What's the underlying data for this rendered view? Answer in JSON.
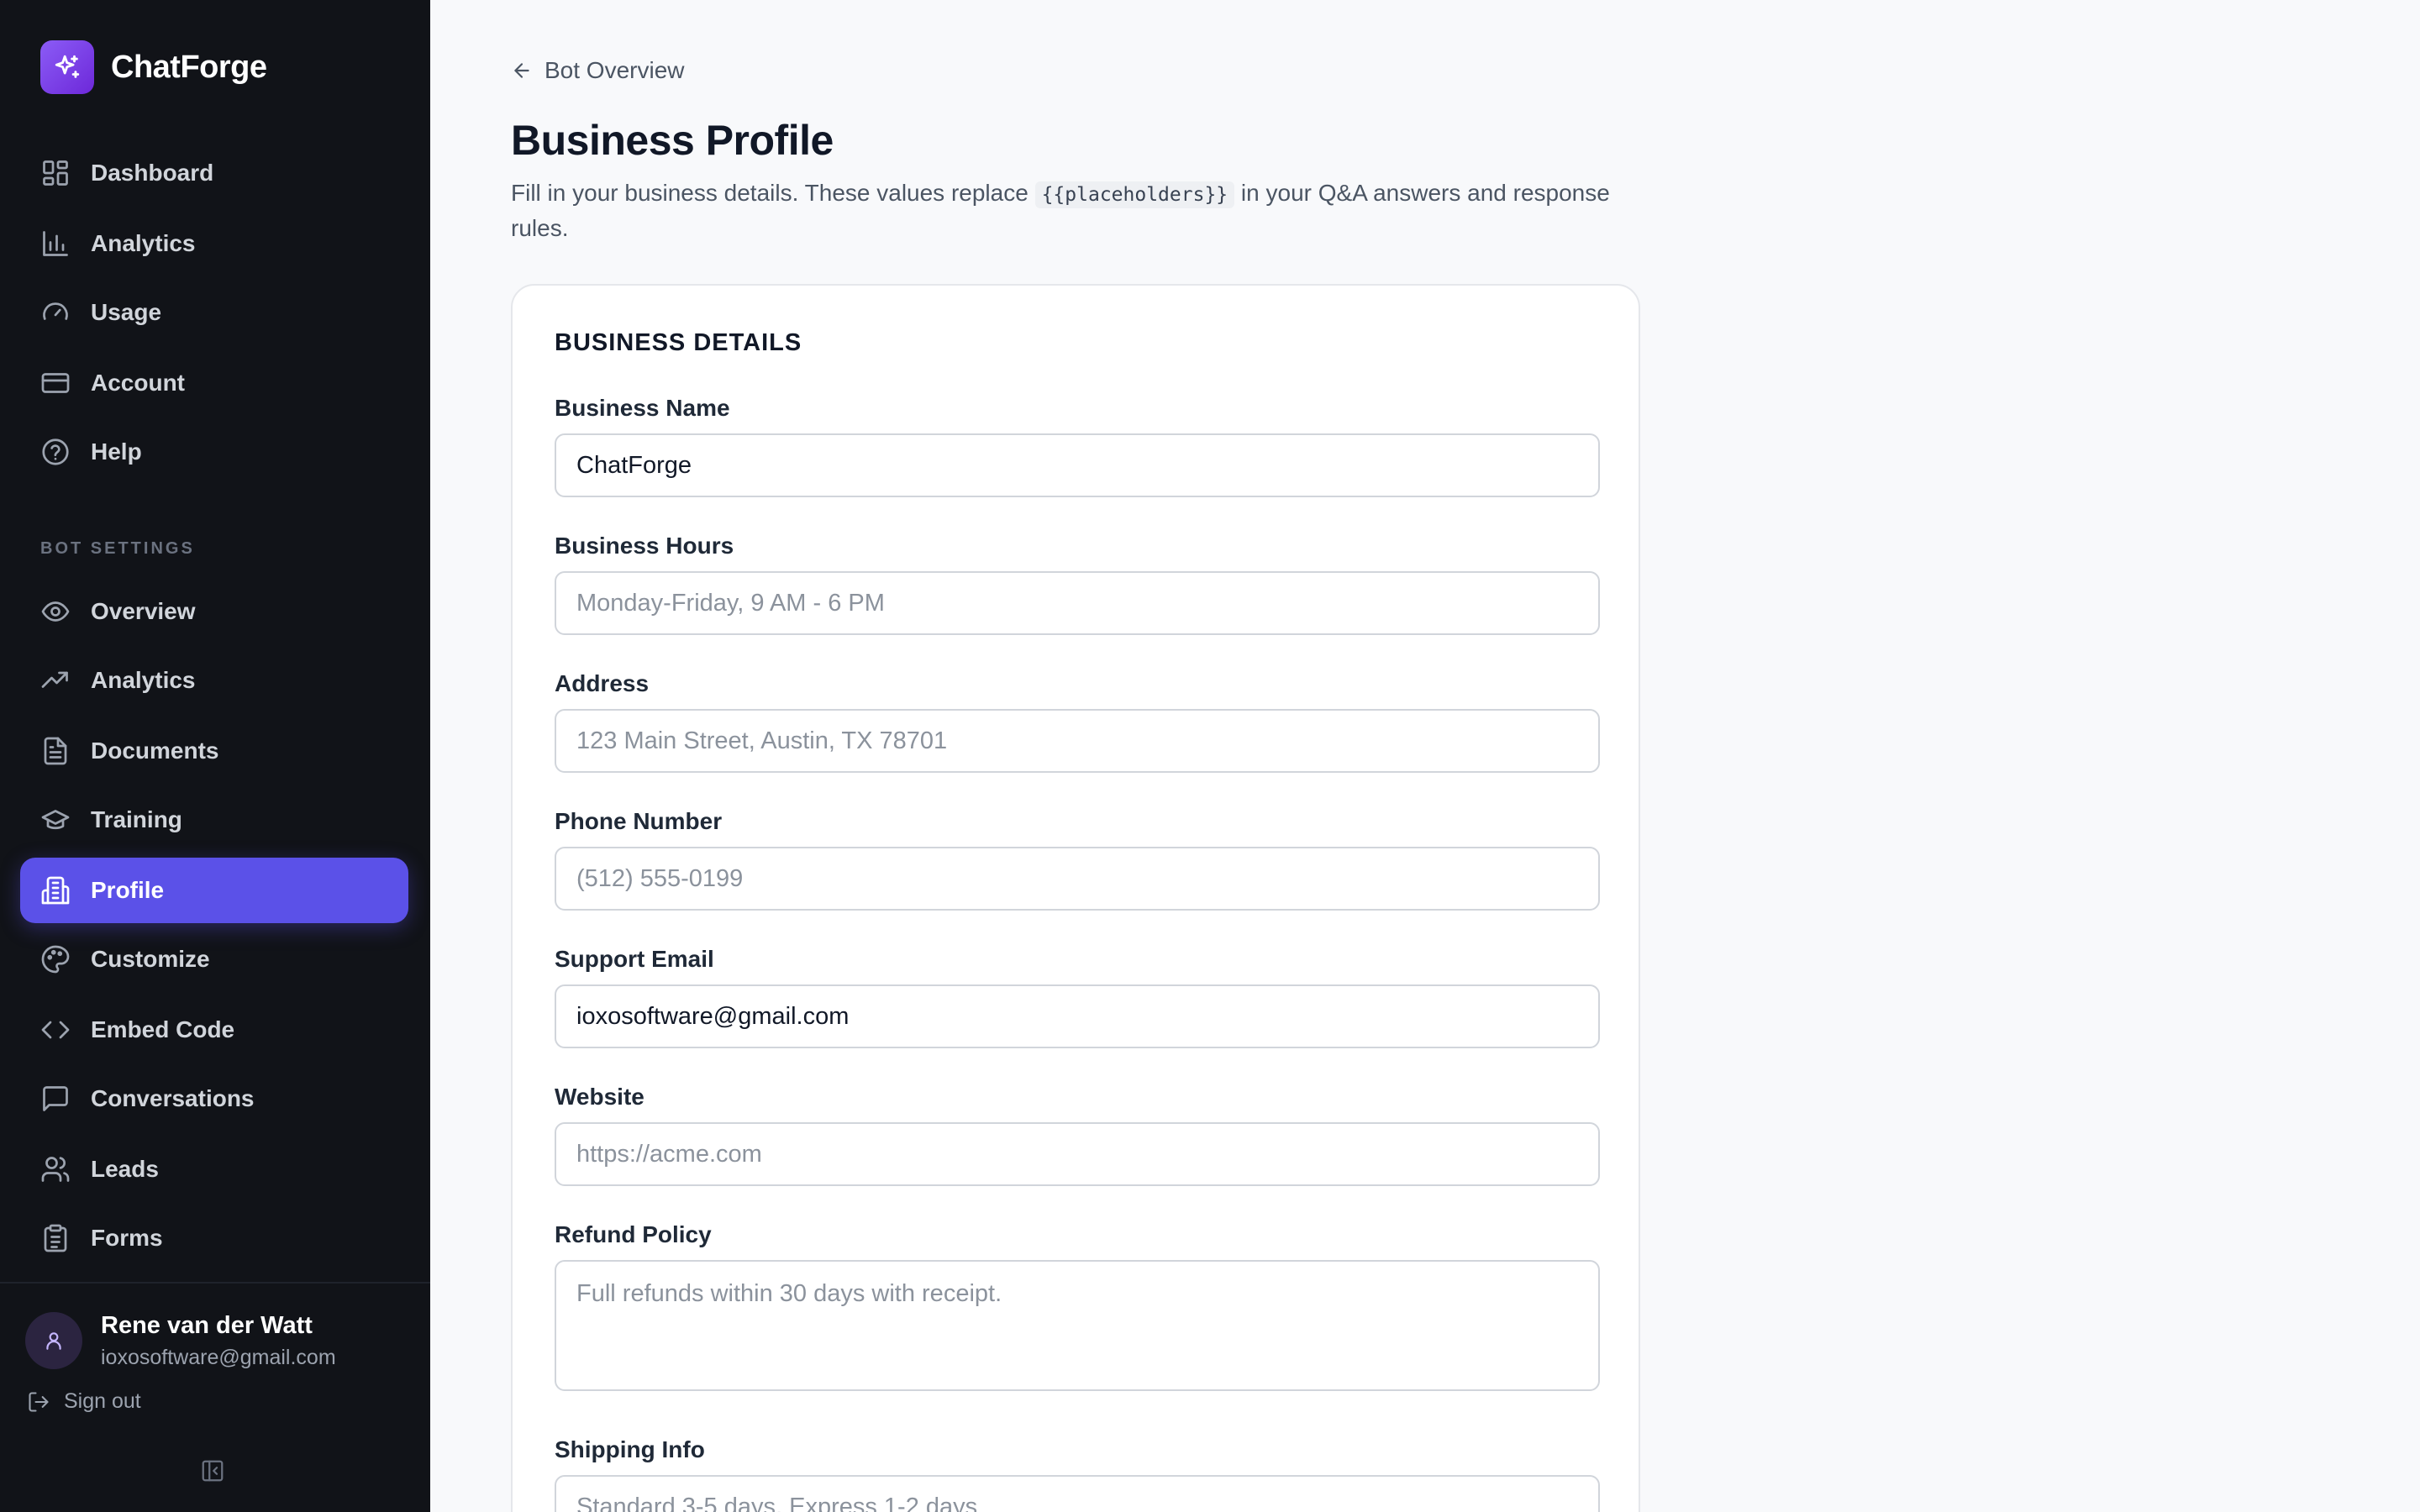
{
  "brand": {
    "name": "ChatForge",
    "logo_icon": "sparkles-icon",
    "accent": "#8b5cf6"
  },
  "nav": {
    "main": [
      {
        "label": "Dashboard",
        "icon": "grid-icon"
      },
      {
        "label": "Analytics",
        "icon": "bar-chart-icon"
      },
      {
        "label": "Usage",
        "icon": "gauge-icon"
      },
      {
        "label": "Account",
        "icon": "credit-card-icon"
      },
      {
        "label": "Help",
        "icon": "help-circle-icon"
      }
    ],
    "section_label": "BOT SETTINGS",
    "bot": [
      {
        "label": "Overview",
        "icon": "eye-icon"
      },
      {
        "label": "Analytics",
        "icon": "trending-up-icon"
      },
      {
        "label": "Documents",
        "icon": "file-text-icon"
      },
      {
        "label": "Training",
        "icon": "graduation-cap-icon"
      },
      {
        "label": "Profile",
        "icon": "building-icon",
        "active": true
      },
      {
        "label": "Customize",
        "icon": "palette-icon"
      },
      {
        "label": "Embed Code",
        "icon": "code-icon"
      },
      {
        "label": "Conversations",
        "icon": "message-square-icon"
      },
      {
        "label": "Leads",
        "icon": "users-icon"
      },
      {
        "label": "Forms",
        "icon": "clipboard-icon"
      }
    ],
    "active_color": "#5b51e8"
  },
  "user": {
    "name": "Rene van der Watt",
    "email": "ioxosoftware@gmail.com",
    "sign_out": "Sign out"
  },
  "page": {
    "back_label": "Bot Overview",
    "title": "Business Profile",
    "desc_before": "Fill in your business details. These values replace ",
    "desc_code": "{{placeholders}}",
    "desc_after": " in your Q&A answers and response rules."
  },
  "form": {
    "section_title": "BUSINESS DETAILS",
    "fields": [
      {
        "label": "Business Name",
        "value": "ChatForge",
        "placeholder": ""
      },
      {
        "label": "Business Hours",
        "value": "",
        "placeholder": "Monday-Friday, 9 AM - 6 PM"
      },
      {
        "label": "Address",
        "value": "",
        "placeholder": "123 Main Street, Austin, TX 78701"
      },
      {
        "label": "Phone Number",
        "value": "",
        "placeholder": "(512) 555-0199"
      },
      {
        "label": "Support Email",
        "value": "ioxosoftware@gmail.com",
        "placeholder": ""
      },
      {
        "label": "Website",
        "value": "",
        "placeholder": "https://acme.com"
      },
      {
        "label": "Refund Policy",
        "value": "",
        "placeholder": "Full refunds within 30 days with receipt."
      },
      {
        "label": "Shipping Info",
        "value": "",
        "placeholder": "Standard 3-5 days, Express 1-2 days"
      }
    ]
  }
}
